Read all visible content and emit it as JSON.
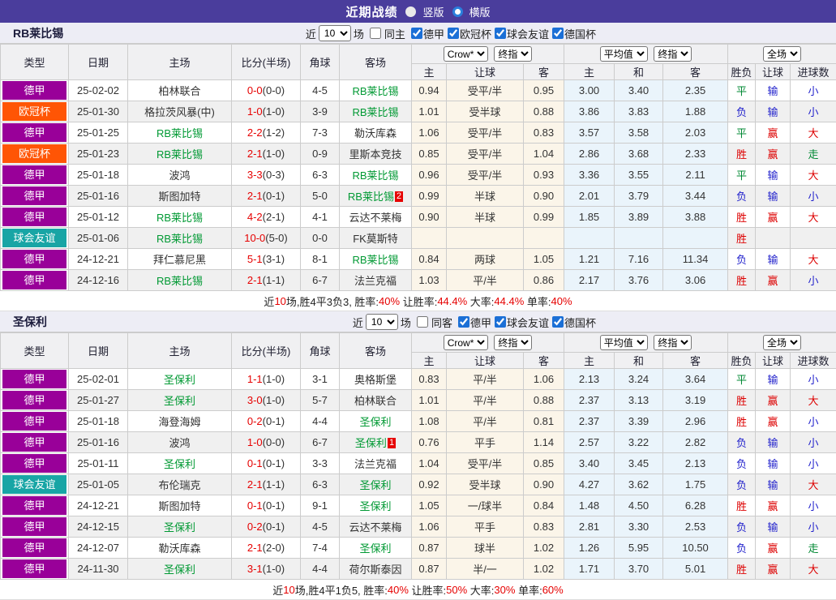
{
  "topbar": {
    "title": "近期战绩",
    "vertical_label": "竖版",
    "horizontal_label": "横版"
  },
  "headers": {
    "near": "近",
    "count": "10",
    "games_suffix": "场",
    "cols": [
      "类型",
      "日期",
      "主场",
      "比分(半场)",
      "角球",
      "客场"
    ],
    "sub": [
      "主",
      "让球",
      "客",
      "主",
      "和",
      "客",
      "胜负",
      "让球",
      "进球数"
    ],
    "odds_select": "Crow*",
    "final_select": "终指",
    "avg_select": "平均值",
    "final_select2": "终指",
    "full_select": "全场"
  },
  "colors": {
    "topbar_bg": "#4a3d9c",
    "accent_blue": "#1b6fd6",
    "league": {
      "德甲": "#990099",
      "欧冠杯": "#ff5505",
      "球会友谊": "#18a5a5"
    },
    "result": {
      "胜": "red",
      "赢": "red",
      "大": "red",
      "负": "blue",
      "输": "blue",
      "小": "blue",
      "平": "green",
      "走": "green"
    }
  },
  "sections": [
    {
      "team": "RB莱比锡",
      "same_label": "同主",
      "same_checked": false,
      "leagues": [
        "德甲",
        "欧冠杯",
        "球会友谊",
        "德国杯"
      ],
      "rows": [
        {
          "league": "德甲",
          "date": "25-02-02",
          "home": "柏林联合",
          "home_green": false,
          "score": "0-0",
          "half": "(0-0)",
          "corner": "4-5",
          "away": "RB莱比锡",
          "away_green": true,
          "away_badge": "",
          "ch": "0.94",
          "hd": "受平/半",
          "ca": "0.95",
          "ah": "3.00",
          "ad": "3.40",
          "aa": "2.35",
          "r1": "平",
          "r2": "输",
          "r3": "小"
        },
        {
          "league": "欧冠杯",
          "date": "25-01-30",
          "home": "格拉茨风暴(中)",
          "home_green": false,
          "score": "1-0",
          "half": "(1-0)",
          "corner": "3-9",
          "away": "RB莱比锡",
          "away_green": true,
          "away_badge": "",
          "ch": "1.01",
          "hd": "受半球",
          "ca": "0.88",
          "ah": "3.86",
          "ad": "3.83",
          "aa": "1.88",
          "r1": "负",
          "r2": "输",
          "r3": "小"
        },
        {
          "league": "德甲",
          "date": "25-01-25",
          "home": "RB莱比锡",
          "home_green": true,
          "score": "2-2",
          "half": "(1-2)",
          "corner": "7-3",
          "away": "勒沃库森",
          "away_green": false,
          "away_badge": "",
          "ch": "1.06",
          "hd": "受平/半",
          "ca": "0.83",
          "ah": "3.57",
          "ad": "3.58",
          "aa": "2.03",
          "r1": "平",
          "r2": "赢",
          "r3": "大"
        },
        {
          "league": "欧冠杯",
          "date": "25-01-23",
          "home": "RB莱比锡",
          "home_green": true,
          "score": "2-1",
          "half": "(1-0)",
          "corner": "0-9",
          "away": "里斯本竞技",
          "away_green": false,
          "away_badge": "",
          "ch": "0.85",
          "hd": "受平/半",
          "ca": "1.04",
          "ah": "2.86",
          "ad": "3.68",
          "aa": "2.33",
          "r1": "胜",
          "r2": "赢",
          "r3": "走"
        },
        {
          "league": "德甲",
          "date": "25-01-18",
          "home": "波鸿",
          "home_green": false,
          "score": "3-3",
          "half": "(0-3)",
          "corner": "6-3",
          "away": "RB莱比锡",
          "away_green": true,
          "away_badge": "",
          "ch": "0.96",
          "hd": "受平/半",
          "ca": "0.93",
          "ah": "3.36",
          "ad": "3.55",
          "aa": "2.11",
          "r1": "平",
          "r2": "输",
          "r3": "大"
        },
        {
          "league": "德甲",
          "date": "25-01-16",
          "home": "斯图加特",
          "home_green": false,
          "score": "2-1",
          "half": "(0-1)",
          "corner": "5-0",
          "away": "RB莱比锡",
          "away_green": true,
          "away_badge": "2",
          "ch": "0.99",
          "hd": "半球",
          "ca": "0.90",
          "ah": "2.01",
          "ad": "3.79",
          "aa": "3.44",
          "r1": "负",
          "r2": "输",
          "r3": "小"
        },
        {
          "league": "德甲",
          "date": "25-01-12",
          "home": "RB莱比锡",
          "home_green": true,
          "score": "4-2",
          "half": "(2-1)",
          "corner": "4-1",
          "away": "云达不莱梅",
          "away_green": false,
          "away_badge": "",
          "ch": "0.90",
          "hd": "半球",
          "ca": "0.99",
          "ah": "1.85",
          "ad": "3.89",
          "aa": "3.88",
          "r1": "胜",
          "r2": "赢",
          "r3": "大"
        },
        {
          "league": "球会友谊",
          "date": "25-01-06",
          "home": "RB莱比锡",
          "home_green": true,
          "score": "10-0",
          "half": "(5-0)",
          "corner": "0-0",
          "away": "FK莫斯特",
          "away_green": false,
          "away_badge": "",
          "ch": "",
          "hd": "",
          "ca": "",
          "ah": "",
          "ad": "",
          "aa": "",
          "r1": "胜",
          "r2": "",
          "r3": ""
        },
        {
          "league": "德甲",
          "date": "24-12-21",
          "home": "拜仁慕尼黑",
          "home_green": false,
          "score": "5-1",
          "half": "(3-1)",
          "corner": "8-1",
          "away": "RB莱比锡",
          "away_green": true,
          "away_badge": "",
          "ch": "0.84",
          "hd": "两球",
          "ca": "1.05",
          "ah": "1.21",
          "ad": "7.16",
          "aa": "11.34",
          "r1": "负",
          "r2": "输",
          "r3": "大"
        },
        {
          "league": "德甲",
          "date": "24-12-16",
          "home": "RB莱比锡",
          "home_green": true,
          "score": "2-1",
          "half": "(1-1)",
          "corner": "6-7",
          "away": "法兰克福",
          "away_green": false,
          "away_badge": "",
          "ch": "1.03",
          "hd": "平/半",
          "ca": "0.86",
          "ah": "2.17",
          "ad": "3.76",
          "aa": "3.06",
          "r1": "胜",
          "r2": "赢",
          "r3": "小"
        }
      ],
      "summary": [
        {
          "t": "近"
        },
        {
          "t": "10",
          "red": true
        },
        {
          "t": "场,胜4平3负3, 胜率:"
        },
        {
          "t": "40%",
          "red": true
        },
        {
          "t": " 让胜率:"
        },
        {
          "t": "44.4%",
          "red": true
        },
        {
          "t": " 大率:"
        },
        {
          "t": "44.4%",
          "red": true
        },
        {
          "t": " 单率:"
        },
        {
          "t": "40%",
          "red": true
        }
      ]
    },
    {
      "team": "圣保利",
      "same_label": "同客",
      "same_checked": false,
      "leagues": [
        "德甲",
        "球会友谊",
        "德国杯"
      ],
      "rows": [
        {
          "league": "德甲",
          "date": "25-02-01",
          "home": "圣保利",
          "home_green": true,
          "score": "1-1",
          "half": "(1-0)",
          "corner": "3-1",
          "away": "奥格斯堡",
          "away_green": false,
          "away_badge": "",
          "ch": "0.83",
          "hd": "平/半",
          "ca": "1.06",
          "ah": "2.13",
          "ad": "3.24",
          "aa": "3.64",
          "r1": "平",
          "r2": "输",
          "r3": "小"
        },
        {
          "league": "德甲",
          "date": "25-01-27",
          "home": "圣保利",
          "home_green": true,
          "score": "3-0",
          "half": "(1-0)",
          "corner": "5-7",
          "away": "柏林联合",
          "away_green": false,
          "away_badge": "",
          "ch": "1.01",
          "hd": "平/半",
          "ca": "0.88",
          "ah": "2.37",
          "ad": "3.13",
          "aa": "3.19",
          "r1": "胜",
          "r2": "赢",
          "r3": "大"
        },
        {
          "league": "德甲",
          "date": "25-01-18",
          "home": "海登海姆",
          "home_green": false,
          "score": "0-2",
          "half": "(0-1)",
          "corner": "4-4",
          "away": "圣保利",
          "away_green": true,
          "away_badge": "",
          "ch": "1.08",
          "hd": "平/半",
          "ca": "0.81",
          "ah": "2.37",
          "ad": "3.39",
          "aa": "2.96",
          "r1": "胜",
          "r2": "赢",
          "r3": "小"
        },
        {
          "league": "德甲",
          "date": "25-01-16",
          "home": "波鸿",
          "home_green": false,
          "score": "1-0",
          "half": "(0-0)",
          "corner": "6-7",
          "away": "圣保利",
          "away_green": true,
          "away_badge": "1",
          "ch": "0.76",
          "hd": "平手",
          "ca": "1.14",
          "ah": "2.57",
          "ad": "3.22",
          "aa": "2.82",
          "r1": "负",
          "r2": "输",
          "r3": "小"
        },
        {
          "league": "德甲",
          "date": "25-01-11",
          "home": "圣保利",
          "home_green": true,
          "score": "0-1",
          "half": "(0-1)",
          "corner": "3-3",
          "away": "法兰克福",
          "away_green": false,
          "away_badge": "",
          "ch": "1.04",
          "hd": "受平/半",
          "ca": "0.85",
          "ah": "3.40",
          "ad": "3.45",
          "aa": "2.13",
          "r1": "负",
          "r2": "输",
          "r3": "小"
        },
        {
          "league": "球会友谊",
          "date": "25-01-05",
          "home": "布伦瑞克",
          "home_green": false,
          "score": "2-1",
          "half": "(1-1)",
          "corner": "6-3",
          "away": "圣保利",
          "away_green": true,
          "away_badge": "",
          "ch": "0.92",
          "hd": "受半球",
          "ca": "0.90",
          "ah": "4.27",
          "ad": "3.62",
          "aa": "1.75",
          "r1": "负",
          "r2": "输",
          "r3": "大"
        },
        {
          "league": "德甲",
          "date": "24-12-21",
          "home": "斯图加特",
          "home_green": false,
          "score": "0-1",
          "half": "(0-1)",
          "corner": "9-1",
          "away": "圣保利",
          "away_green": true,
          "away_badge": "",
          "ch": "1.05",
          "hd": "一/球半",
          "ca": "0.84",
          "ah": "1.48",
          "ad": "4.50",
          "aa": "6.28",
          "r1": "胜",
          "r2": "赢",
          "r3": "小"
        },
        {
          "league": "德甲",
          "date": "24-12-15",
          "home": "圣保利",
          "home_green": true,
          "score": "0-2",
          "half": "(0-1)",
          "corner": "4-5",
          "away": "云达不莱梅",
          "away_green": false,
          "away_badge": "",
          "ch": "1.06",
          "hd": "平手",
          "ca": "0.83",
          "ah": "2.81",
          "ad": "3.30",
          "aa": "2.53",
          "r1": "负",
          "r2": "输",
          "r3": "小"
        },
        {
          "league": "德甲",
          "date": "24-12-07",
          "home": "勒沃库森",
          "home_green": false,
          "score": "2-1",
          "half": "(2-0)",
          "corner": "7-4",
          "away": "圣保利",
          "away_green": true,
          "away_badge": "",
          "ch": "0.87",
          "hd": "球半",
          "ca": "1.02",
          "ah": "1.26",
          "ad": "5.95",
          "aa": "10.50",
          "r1": "负",
          "r2": "赢",
          "r3": "走"
        },
        {
          "league": "德甲",
          "date": "24-11-30",
          "home": "圣保利",
          "home_green": true,
          "score": "3-1",
          "half": "(1-0)",
          "corner": "4-4",
          "away": "荷尔斯泰因",
          "away_green": false,
          "away_badge": "",
          "ch": "0.87",
          "hd": "半/一",
          "ca": "1.02",
          "ah": "1.71",
          "ad": "3.70",
          "aa": "5.01",
          "r1": "胜",
          "r2": "赢",
          "r3": "大"
        }
      ],
      "summary": [
        {
          "t": "近"
        },
        {
          "t": "10",
          "red": true
        },
        {
          "t": "场,胜4平1负5, 胜率:"
        },
        {
          "t": "40%",
          "red": true
        },
        {
          "t": " 让胜率:"
        },
        {
          "t": "50%",
          "red": true
        },
        {
          "t": " 大率:"
        },
        {
          "t": "30%",
          "red": true
        },
        {
          "t": " 单率:"
        },
        {
          "t": "60%",
          "red": true
        }
      ]
    }
  ]
}
